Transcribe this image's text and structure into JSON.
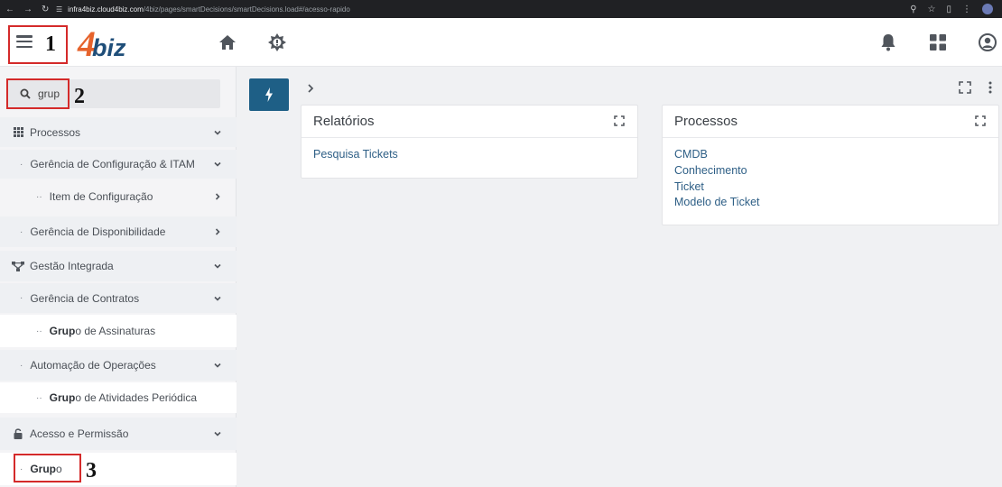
{
  "browser": {
    "url_host": "infra4biz.cloud4biz.com",
    "url_path": "/4biz/pages/smartDecisions/smartDecisions.load#/acesso-rapido"
  },
  "header": {
    "logo_number": "4",
    "logo_text": "biz"
  },
  "annotations": {
    "one": "1",
    "two": "2",
    "three": "3",
    "color": "#d42a2a"
  },
  "sidebar": {
    "search": {
      "value": "grup"
    },
    "items": [
      {
        "label": "Processos",
        "icon": "grid-icon"
      },
      {
        "label": "Gerência de Configuração & ITAM"
      },
      {
        "label": "Item de Configuração"
      },
      {
        "label": "Gerência de Disponibilidade"
      },
      {
        "label": "Gestão Integrada",
        "icon": "hierarchy-icon"
      },
      {
        "label": "Gerência de Contratos"
      },
      {
        "label_bold": "Grup",
        "label_rest": "o de Assinaturas"
      },
      {
        "label": "Automação de Operações"
      },
      {
        "label_bold": "Grup",
        "label_rest": "o de Atividades Periódica"
      },
      {
        "label": "Acesso e Permissão",
        "icon": "lock-icon"
      },
      {
        "label_bold": "Grup",
        "label_rest": "o"
      }
    ]
  },
  "main": {
    "cards": [
      {
        "title": "Relatórios",
        "links": [
          "Pesquisa Tickets"
        ]
      },
      {
        "title": "Processos",
        "links": [
          "CMDB",
          "Conhecimento",
          "Ticket",
          "Modelo de Ticket"
        ]
      }
    ]
  },
  "colors": {
    "accent": "#1e5f86",
    "link": "#2e5f86",
    "logo_orange": "#e6632c",
    "logo_blue": "#1f4e79"
  }
}
